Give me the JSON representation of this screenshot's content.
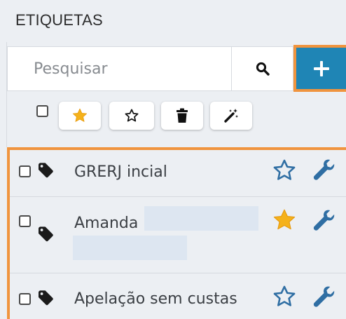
{
  "panel": {
    "title": "ETIQUETAS"
  },
  "search": {
    "placeholder": "Pesquisar",
    "value": ""
  },
  "toolbar": {
    "items": [
      {
        "icon": "star-filled-icon",
        "color": "#f5b21b"
      },
      {
        "icon": "star-outline-icon"
      },
      {
        "icon": "trash-icon"
      },
      {
        "icon": "magic-wand-icon"
      }
    ]
  },
  "tags": [
    {
      "label": "GRERJ incial",
      "favorite": false
    },
    {
      "label": "Amanda",
      "favorite": true
    },
    {
      "label": "Apelação sem custas",
      "favorite": false
    }
  ],
  "colors": {
    "accent": "#1f85b5",
    "highlight": "#f0943e",
    "star": "#2f6ea3",
    "star_filled": "#f5b21b"
  }
}
